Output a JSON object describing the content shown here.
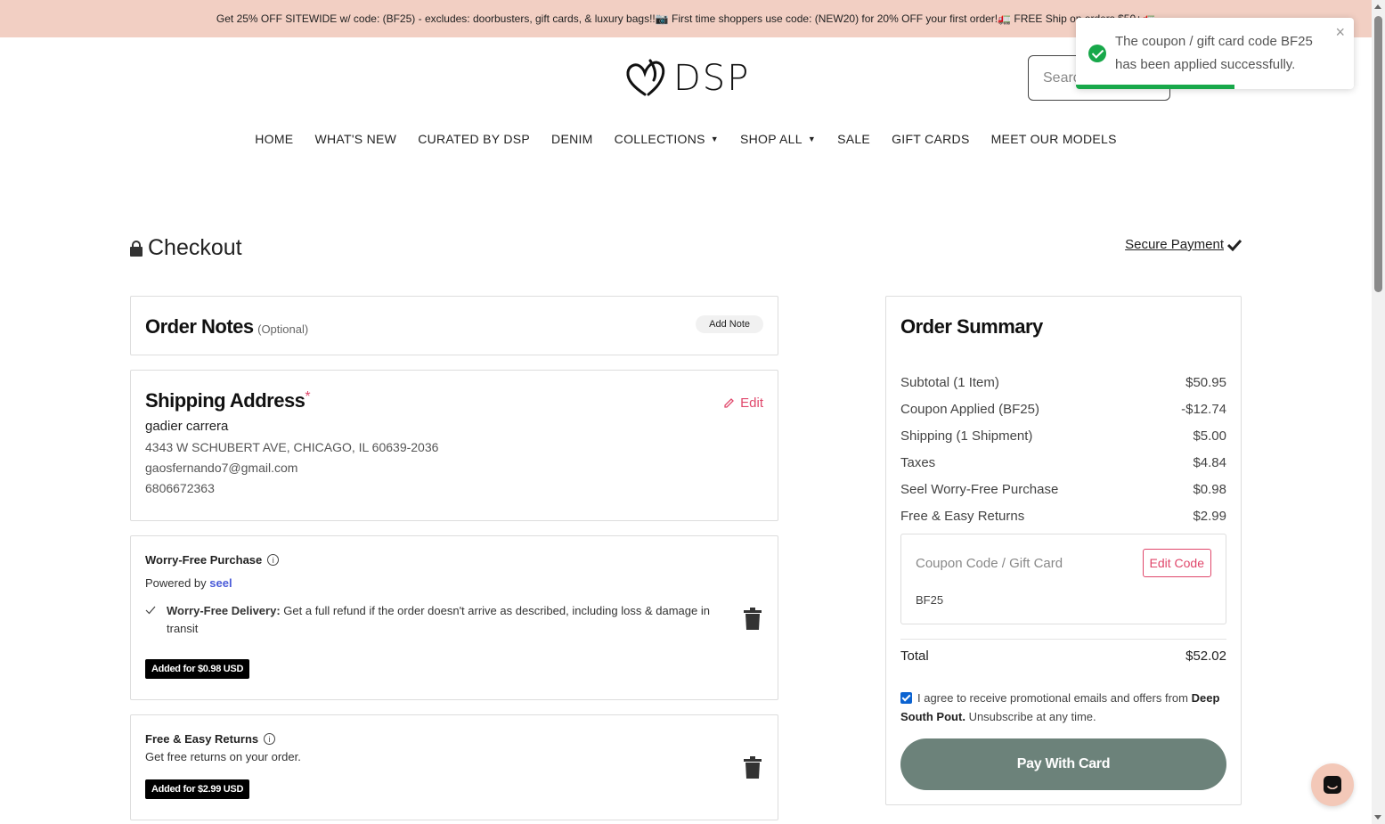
{
  "promo": {
    "text": "Get 25% OFF SITEWIDE w/ code: (BF25) - excludes: doorbusters, gift cards, & luxury bags!!📷 First time shoppers use code: (NEW20) for 20% OFF your first order!🚛 FREE Ship on orders $50+🚛"
  },
  "header": {
    "logo_text": "DSP",
    "search_placeholder": "Searc"
  },
  "nav": {
    "items": [
      {
        "label": "HOME",
        "dropdown": false
      },
      {
        "label": "WHAT'S NEW",
        "dropdown": false
      },
      {
        "label": "CURATED BY DSP",
        "dropdown": false
      },
      {
        "label": "DENIM",
        "dropdown": false
      },
      {
        "label": "COLLECTIONS",
        "dropdown": true
      },
      {
        "label": "SHOP ALL",
        "dropdown": true
      },
      {
        "label": "SALE",
        "dropdown": false
      },
      {
        "label": "GIFT CARDS",
        "dropdown": false
      },
      {
        "label": "MEET OUR MODELS",
        "dropdown": false
      }
    ]
  },
  "checkout": {
    "title": "Checkout",
    "secure_payment": "Secure Payment"
  },
  "order_notes": {
    "title": "Order Notes",
    "optional": "(Optional)",
    "add_note": "Add Note"
  },
  "shipping": {
    "title": "Shipping Address",
    "required_mark": "*",
    "edit": "Edit",
    "name": "gadier carrera",
    "address": "4343 W SCHUBERT AVE, CHICAGO, IL 60639-2036",
    "email": "gaosfernando7@gmail.com",
    "phone": "6806672363"
  },
  "worry_free": {
    "title": "Worry-Free Purchase",
    "powered_by": "Powered by",
    "brand": "seel",
    "feature_title": "Worry-Free Delivery:",
    "feature_text": "Get a full refund if the order doesn't arrive as described, including loss & damage in transit",
    "badge": "Added for $0.98 USD"
  },
  "returns": {
    "title": "Free & Easy Returns",
    "text": "Get free returns on your order.",
    "badge": "Added for $2.99 USD"
  },
  "summary": {
    "title": "Order Summary",
    "rows": [
      {
        "label": "Subtotal (1 Item)",
        "value": "$50.95"
      },
      {
        "label": "Coupon Applied (BF25)",
        "value": "-$12.74"
      },
      {
        "label": "Shipping (1 Shipment)",
        "value": "$5.00"
      },
      {
        "label": "Taxes",
        "value": "$4.84"
      },
      {
        "label": "Seel Worry-Free Purchase",
        "value": "$0.98"
      },
      {
        "label": "Free & Easy Returns",
        "value": "$2.99"
      }
    ],
    "coupon_placeholder": "Coupon Code / Gift Card",
    "edit_code": "Edit Code",
    "applied_code": "BF25",
    "total_label": "Total",
    "total_value": "$52.02",
    "agree_prefix": "I agree to receive promotional emails and offers from",
    "agree_brand": "Deep South Pout.",
    "agree_suffix": "Unsubscribe at any time.",
    "agree_checked": true,
    "pay_button": "Pay With Card"
  },
  "toast": {
    "message": "The coupon / gift card code BF25 has been applied successfully.",
    "progress": 0.57
  },
  "colors": {
    "promo_bg": "#f2cfc3",
    "accent_pink": "#e0476b",
    "pay_button": "#6c827a",
    "success_green": "#18a84a",
    "seel_blue": "#4a5bd8"
  }
}
